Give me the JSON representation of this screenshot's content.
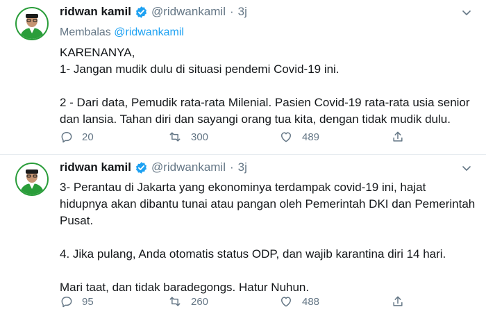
{
  "colors": {
    "link": "#1da1f2",
    "secondary": "#657786",
    "text": "#14171a",
    "avatar_ring": "#2a9d3a"
  },
  "tweets": [
    {
      "name": "ridwan kamil",
      "handle": "@ridwankamil",
      "separator": "·",
      "time": "3j",
      "verified_icon": "verified-badge-icon",
      "replying_prefix": "Membalas",
      "replying_to": "@ridwankamil",
      "lines": [
        "KARENANYA,",
        "1- Jangan mudik dulu di situasi pendemi Covid-19 ini.",
        "",
        "2 - Dari data, Pemudik rata-rata Milenial. Pasien Covid-19 rata-rata usia senior",
        "dan lansia. Tahan diri dan sayangi orang tua kita, dengan tidak mudik dulu."
      ],
      "replies": "20",
      "retweets": "300",
      "likes": "489"
    },
    {
      "name": "ridwan kamil",
      "handle": "@ridwankamil",
      "separator": "·",
      "time": "3j",
      "verified_icon": "verified-badge-icon",
      "lines": [
        "3- Perantau di Jakarta yang ekonominya terdampak covid-19 ini, hajat",
        "hidupnya akan dibantu tunai atau pangan oleh Pemerintah DKI dan Pemerintah",
        "Pusat.",
        "",
        "4. Jika pulang, Anda otomatis status ODP, dan wajib karantina diri 14 hari.",
        "",
        "Mari taat, dan tidak baradegongs. Hatur Nuhun."
      ],
      "replies": "95",
      "retweets": "260",
      "likes": "488"
    }
  ]
}
